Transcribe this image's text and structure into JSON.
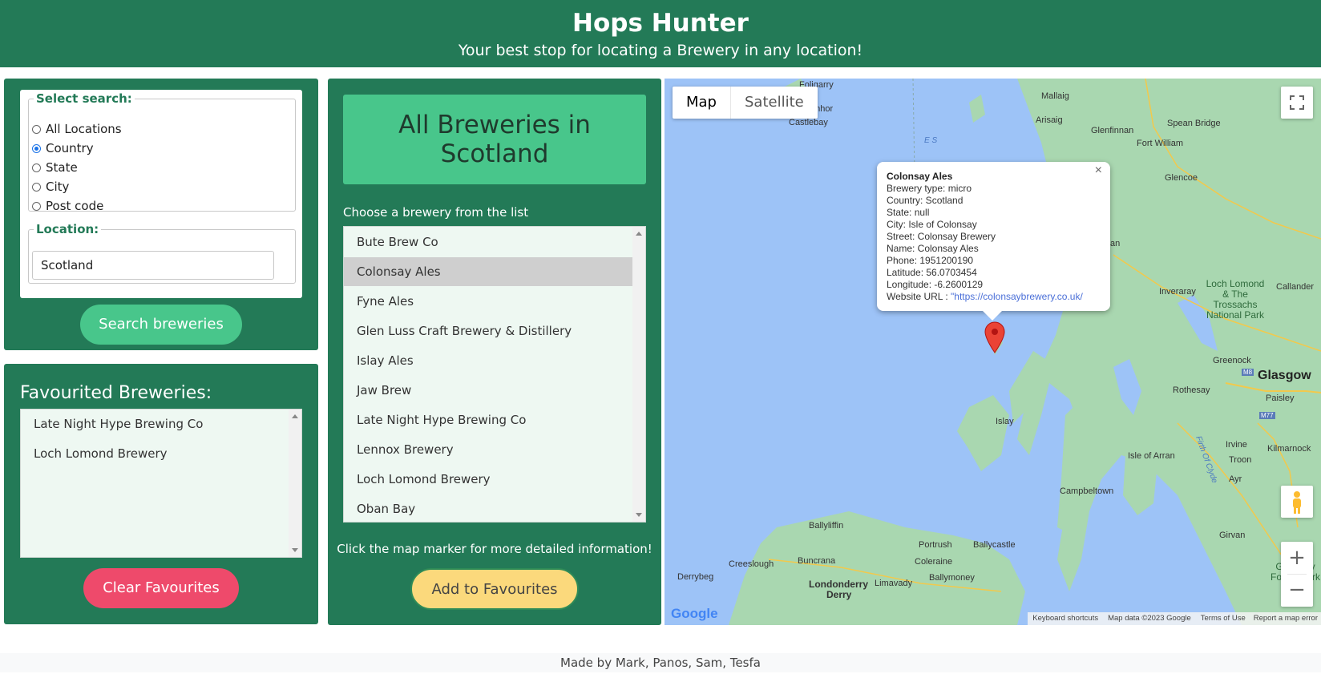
{
  "header": {
    "title": "Hops Hunter",
    "subtitle": "Your best stop for locating a Brewery in any location!"
  },
  "search": {
    "legend": "Select search:",
    "options": [
      "All Locations",
      "Country",
      "State",
      "City",
      "Post code"
    ],
    "selected": "Country",
    "location_legend": "Location:",
    "location_value": "Scotland",
    "button": "Search breweries"
  },
  "favourites": {
    "title": "Favourited Breweries:",
    "items": [
      "Late Night Hype Brewing Co",
      "Loch Lomond Brewery"
    ],
    "clear_button": "Clear Favourites"
  },
  "breweries": {
    "heading": "All Breweries in Scotland",
    "prompt": "Choose a brewery from the list",
    "items": [
      "Bute Brew Co",
      "Colonsay Ales",
      "Fyne Ales",
      "Glen Luss Craft Brewery & Distillery",
      "Islay Ales",
      "Jaw Brew",
      "Late Night Hype Brewing Co",
      "Lennox Brewery",
      "Loch Lomond Brewery",
      "Oban Bay"
    ],
    "selected": "Colonsay Ales",
    "hint": "Click the map marker for more detailed information!",
    "add_button": "Add to Favourites"
  },
  "map": {
    "type_map": "Map",
    "type_satellite": "Satellite",
    "popup": {
      "title": "Colonsay Ales",
      "lines": [
        "Brewery type: micro",
        "Country: Scotland",
        "State: null",
        "City: Isle of Colonsay",
        "Street: Colonsay Brewery",
        "Name: Colonsay Ales",
        "Phone: 1951200190",
        "Latitude: 56.0703454",
        "Longitude: -6.2600129"
      ],
      "website_label": "Website URL : ",
      "website_url": "\"https://colonsaybrewery.co.uk/",
      "close": "×"
    },
    "places": {
      "foligarry": "Foligarry",
      "ardmhor": "Ardmhor",
      "castlebay": "Castlebay",
      "mallaig": "Mallaig",
      "arisaig": "Arisaig",
      "glenfinnan": "Glenfinnan",
      "spean_bridge": "Spean Bridge",
      "fort_william": "Fort William",
      "glencoe": "Glencoe",
      "oban": "an",
      "inveraray": "Inveraray",
      "loch_lomond": "Loch Lomond & The Trossachs National Park",
      "callander": "Callander",
      "greenock": "Greenock",
      "glasgow": "Glasgow",
      "rothesay": "Rothesay",
      "paisley": "Paisley",
      "islay": "Islay",
      "irvine": "Irvine",
      "kilmarnock": "Kilmarnock",
      "isle_of_arran": "Isle of Arran",
      "troon": "Troon",
      "ayr": "Ayr",
      "firth_of_clyde": "Firth Of Clyde",
      "campbeltown": "Campbeltown",
      "girvan": "Girvan",
      "ballyliffin": "Ballyliffin",
      "portrush": "Portrush",
      "ballycastle": "Ballycastle",
      "coleraine": "Coleraine",
      "creeslough": "Creeslough",
      "buncrana": "Buncrana",
      "ballymoney": "Ballymoney",
      "derrybeg": "Derrybeg",
      "londonderry": "Londonderry",
      "derry": "Derry",
      "limavady": "Limavady",
      "galloway": "Galloway Forest Park",
      "hebrides": "E S",
      "m8": "M8",
      "m77": "M77"
    },
    "footer": {
      "shortcuts": "Keyboard shortcuts",
      "mapdata": "Map data ©2023 Google",
      "terms": "Terms of Use",
      "report": "Report a map error",
      "logo": "Google"
    }
  },
  "footer": {
    "credits": "Made by Mark, Panos, Sam, Tesfa"
  }
}
